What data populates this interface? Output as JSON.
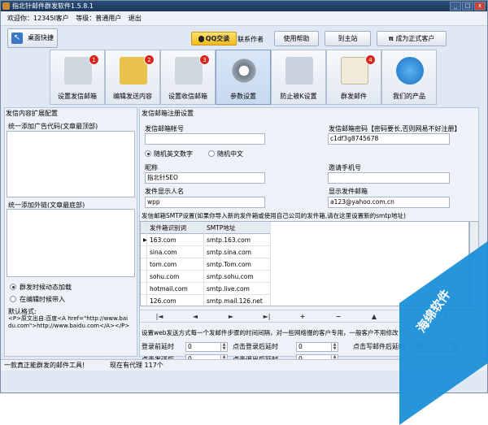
{
  "window": {
    "title": "指北针邮件群发软件1.5.8.1",
    "controls": [
      "_",
      "□",
      "x"
    ]
  },
  "userbar": {
    "welcome": "欢迎你：12345l客户",
    "level": "等级：普通用户",
    "logout": "退出"
  },
  "toolbar": {
    "desktop_shortcut": "桌面快捷",
    "qq_chat": "QQ交谈",
    "contact_author": "联系作者",
    "help": "使用帮助",
    "to_main_site": "到主站",
    "become_official": "成为正式客户"
  },
  "ribbon": [
    {
      "label": "设置发信邮箱",
      "badge": "1"
    },
    {
      "label": "编辑发送内容",
      "badge": "2"
    },
    {
      "label": "设置收信邮箱",
      "badge": "3"
    },
    {
      "label": "参数设置",
      "badge": ""
    },
    {
      "label": "防止被K设置",
      "badge": ""
    },
    {
      "label": "群发邮件",
      "badge": "4"
    },
    {
      "label": "我们的产品",
      "badge": ""
    }
  ],
  "left": {
    "title": "发信内容扩展配置",
    "ad_label": "统一添加广告代码(文章最顶部)",
    "link_label": "统一添加外链(文章最底部)",
    "opt1": "群发时候动态加载",
    "opt2": "在编辑时候带入",
    "default_fmt_label": "默认格式:",
    "default_fmt": "<P>原文出自:百度<A href=\"http://www.baidu.com\">http://www.baidu.com</A></P>"
  },
  "right": {
    "title": "发信邮箱注册设置",
    "account_label": "发信邮箱帐号",
    "account_value": "",
    "password_label": "发信邮箱密码【密码要长,否则网易不好注册】",
    "password_value": "c1df3g8745678",
    "radio1": "随机英文数字",
    "radio2": "随机中文",
    "nickname_label": "昵称",
    "nickname_value": "指北针SEO",
    "phone_label": "邀请手机号",
    "phone_value": "",
    "sender_label": "发件显示人名",
    "sender_value": "wpp",
    "show_mail_label": "显示发件邮箱",
    "show_mail_value": "a123@yahoo.com.cn",
    "smtp_title": "发信邮箱SMTP设置(如果你导入新的发件箱或使用自己公司的发件箱,请在这里设置新的smtp地址)",
    "grid_headers": [
      "发件箱识别词",
      "SMTP地址"
    ],
    "grid_rows": [
      [
        "163.com",
        "smtp.163.com"
      ],
      [
        "sina.com",
        "smtp.sina.com"
      ],
      [
        "tom.com",
        "smtp.Tom.com"
      ],
      [
        "sohu.com",
        "smtp.sohu.com"
      ],
      [
        "hotmail.com",
        "smtp.live.com"
      ],
      [
        "126.com",
        "smtp.mail.126.net"
      ]
    ],
    "nav": [
      "|◄",
      "◄",
      "►",
      "►|",
      "+",
      "−",
      "▲",
      "✓",
      "✕"
    ],
    "interval_text": "设置web发送方式每一个发邮件步骤的时间间隔，对一些网络慢的客户专用，一般客户不用修改",
    "login_delay_label": "登录前延时",
    "login_delay_value": "0",
    "after_login_label": "点击登录后延时",
    "after_login_value": "0",
    "after_write_label": "点击写邮件后延时",
    "after_write_value": "0",
    "after_send_label": "点击发送后",
    "after_send_value": "0",
    "after_logout_label": "点击退出后延时",
    "after_logout_value": "0"
  },
  "status": {
    "left": "一款真正能群发的邮件工具!",
    "right": "现在有代理 117个"
  },
  "watermark": {
    "text": "海绵软件"
  }
}
